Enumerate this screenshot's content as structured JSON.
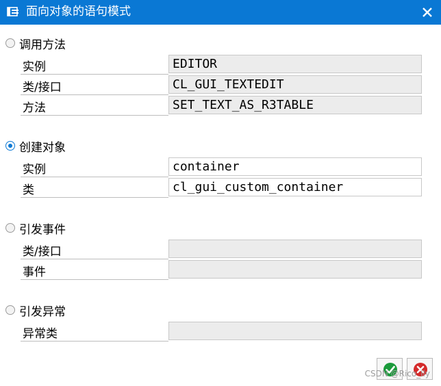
{
  "window": {
    "title": "面向对象的语句模式",
    "title_icon": "form-icon",
    "close_icon": "close-icon"
  },
  "call_method": {
    "radio_label": "调用方法",
    "selected": false,
    "instance_label": "实例",
    "instance_value": "EDITOR",
    "class_interface_label": "类/接口",
    "class_interface_value": "CL_GUI_TEXTEDIT",
    "method_label": "方法",
    "method_value": "SET_TEXT_AS_R3TABLE"
  },
  "create_object": {
    "radio_label": "创建对象",
    "selected": true,
    "instance_label": "实例",
    "instance_value": "container",
    "class_label": "类",
    "class_value": "cl_gui_custom_container"
  },
  "raise_event": {
    "radio_label": "引发事件",
    "selected": false,
    "class_interface_label": "类/接口",
    "class_interface_value": "",
    "event_label": "事件",
    "event_value": ""
  },
  "raise_exception": {
    "radio_label": "引发异常",
    "selected": false,
    "exception_class_label": "异常类",
    "exception_class_value": ""
  },
  "buttons": {
    "confirm_icon": "green-check-icon",
    "cancel_icon": "red-cancel-icon"
  },
  "watermark": "CSDN @Rico_lly",
  "colors": {
    "titlebar": "#0a78d4",
    "readonly_field": "#ececec",
    "confirm_green": "#1a9a3a",
    "cancel_red": "#d42a2a"
  }
}
